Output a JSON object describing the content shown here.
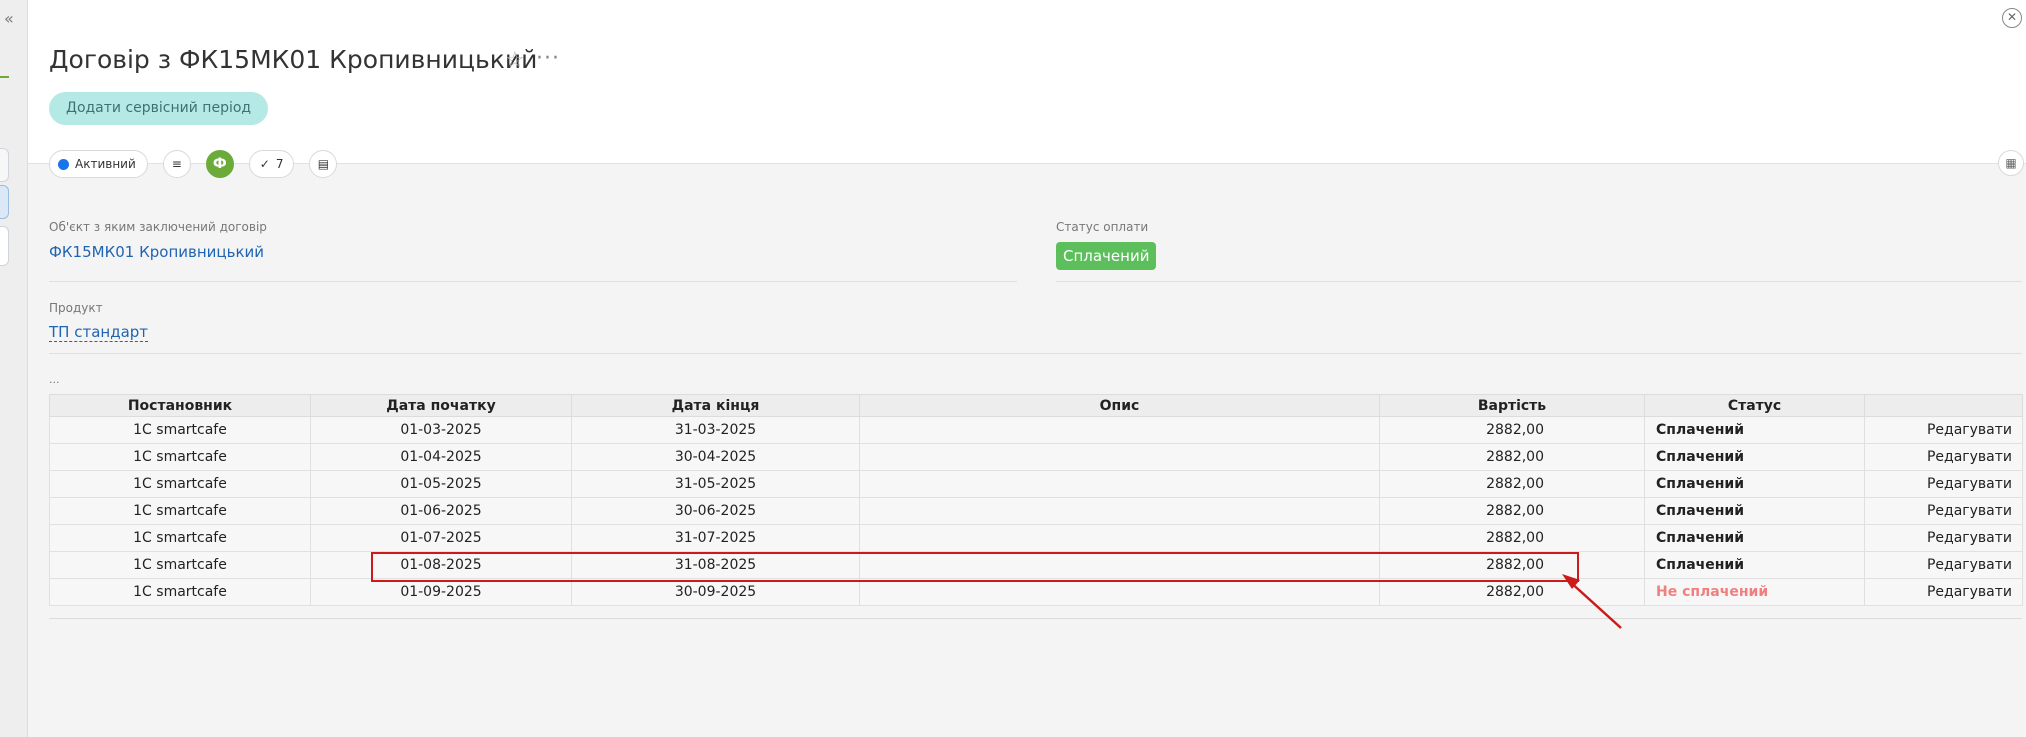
{
  "nav": {
    "collapse_glyph": "«"
  },
  "header": {
    "title": "Договір з ФК15МК01 Кропивницький",
    "star_glyph": "☆",
    "more_glyph": "···",
    "close_glyph": "✕",
    "add_period_label": "Додати сервісний період"
  },
  "toolbar": {
    "status_label": "Активний",
    "status_color": "#1a73e8",
    "list_glyph": "≡",
    "phi_glyph": "Ф",
    "check_glyph": "✓",
    "count": "7",
    "notes_glyph": "▤",
    "calendar_glyph": "▦"
  },
  "fields": {
    "object_label": "Об'єкт з яким заключений договір",
    "object_value": "ФК15МК01 Кропивницький",
    "payment_status_label": "Статус оплати",
    "payment_status_value": "Сплачений",
    "product_label": "Продукт",
    "product_value": "ТП стандарт",
    "section_dots": "..."
  },
  "table": {
    "headers": [
      "Постановник",
      "Дата початку",
      "Дата кінця",
      "Опис",
      "Вартість",
      "Статус",
      ""
    ],
    "rows": [
      {
        "provider": "1С smartcafe",
        "start": "01-03-2025",
        "end": "31-03-2025",
        "desc": "",
        "price": "2882,00",
        "status": "Сплачений",
        "action": "Редагувати"
      },
      {
        "provider": "1С smartcafe",
        "start": "01-04-2025",
        "end": "30-04-2025",
        "desc": "",
        "price": "2882,00",
        "status": "Сплачений",
        "action": "Редагувати"
      },
      {
        "provider": "1С smartcafe",
        "start": "01-05-2025",
        "end": "31-05-2025",
        "desc": "",
        "price": "2882,00",
        "status": "Сплачений",
        "action": "Редагувати"
      },
      {
        "provider": "1С smartcafe",
        "start": "01-06-2025",
        "end": "30-06-2025",
        "desc": "",
        "price": "2882,00",
        "status": "Сплачений",
        "action": "Редагувати"
      },
      {
        "provider": "1С smartcafe",
        "start": "01-07-2025",
        "end": "31-07-2025",
        "desc": "",
        "price": "2882,00",
        "status": "Сплачений",
        "action": "Редагувати"
      },
      {
        "provider": "1С smartcafe",
        "start": "01-08-2025",
        "end": "31-08-2025",
        "desc": "",
        "price": "2882,00",
        "status": "Сплачений",
        "action": "Редагувати"
      },
      {
        "provider": "1С smartcafe",
        "start": "01-09-2025",
        "end": "30-09-2025",
        "desc": "",
        "price": "2882,00",
        "status": "Не сплачений",
        "action": "Редагувати"
      }
    ]
  },
  "colors": {
    "paid": "#3cb44b",
    "unpaid": "#f08080",
    "link": "#1f64b3",
    "annotation": "#cc1a1a",
    "accent_green": "#6aab3a"
  }
}
